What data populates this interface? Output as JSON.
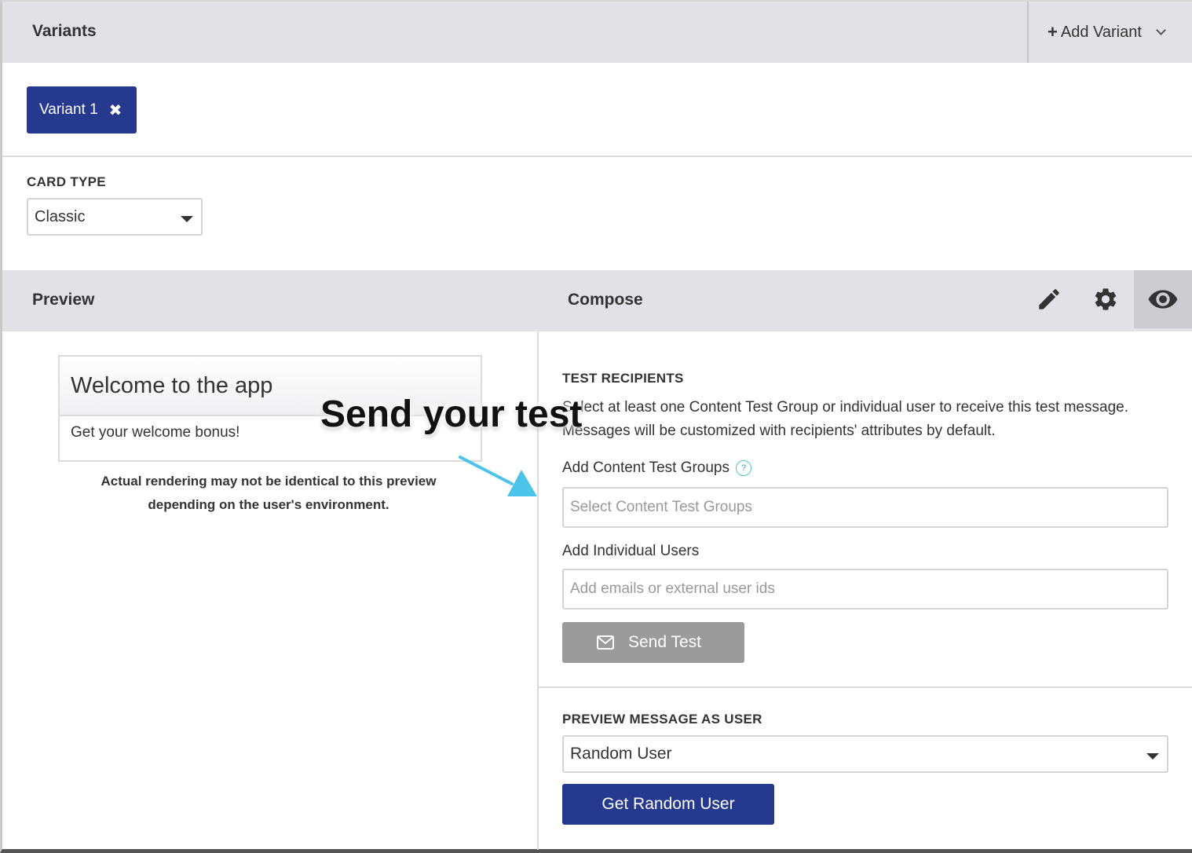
{
  "variants": {
    "title": "Variants",
    "add_variant_label": "Add Variant",
    "tabs": [
      {
        "label": "Variant 1"
      }
    ]
  },
  "card_type": {
    "label": "CARD TYPE",
    "selected": "Classic"
  },
  "compose_bar": {
    "preview_title": "Preview",
    "compose_title": "Compose",
    "tools": [
      "pencil-icon",
      "gear-icon",
      "eye-icon"
    ]
  },
  "preview": {
    "card_title": "Welcome to the app",
    "card_body": "Get your welcome bonus!",
    "note_line1": "Actual rendering may not be identical to this preview",
    "note_line2": "depending on the user's environment."
  },
  "test_recipients": {
    "heading": "TEST RECIPIENTS",
    "description": "Select at least one Content Test Group or individual user to receive this test message. Messages will be customized with recipients' attributes by default.",
    "groups_label": "Add Content Test Groups",
    "groups_placeholder": "Select Content Test Groups",
    "users_label": "Add Individual Users",
    "users_placeholder": "Add emails or external user ids",
    "send_button": "Send Test"
  },
  "preview_as_user": {
    "heading": "PREVIEW MESSAGE AS USER",
    "selected": "Random User",
    "button": "Get Random User"
  },
  "annotation": {
    "text": "Send your test"
  },
  "colors": {
    "primary": "#253a8f",
    "header_bg": "#e2e2e6",
    "disabled_button": "#9b9b9b",
    "annotation_arrow": "#4cc3e8"
  }
}
